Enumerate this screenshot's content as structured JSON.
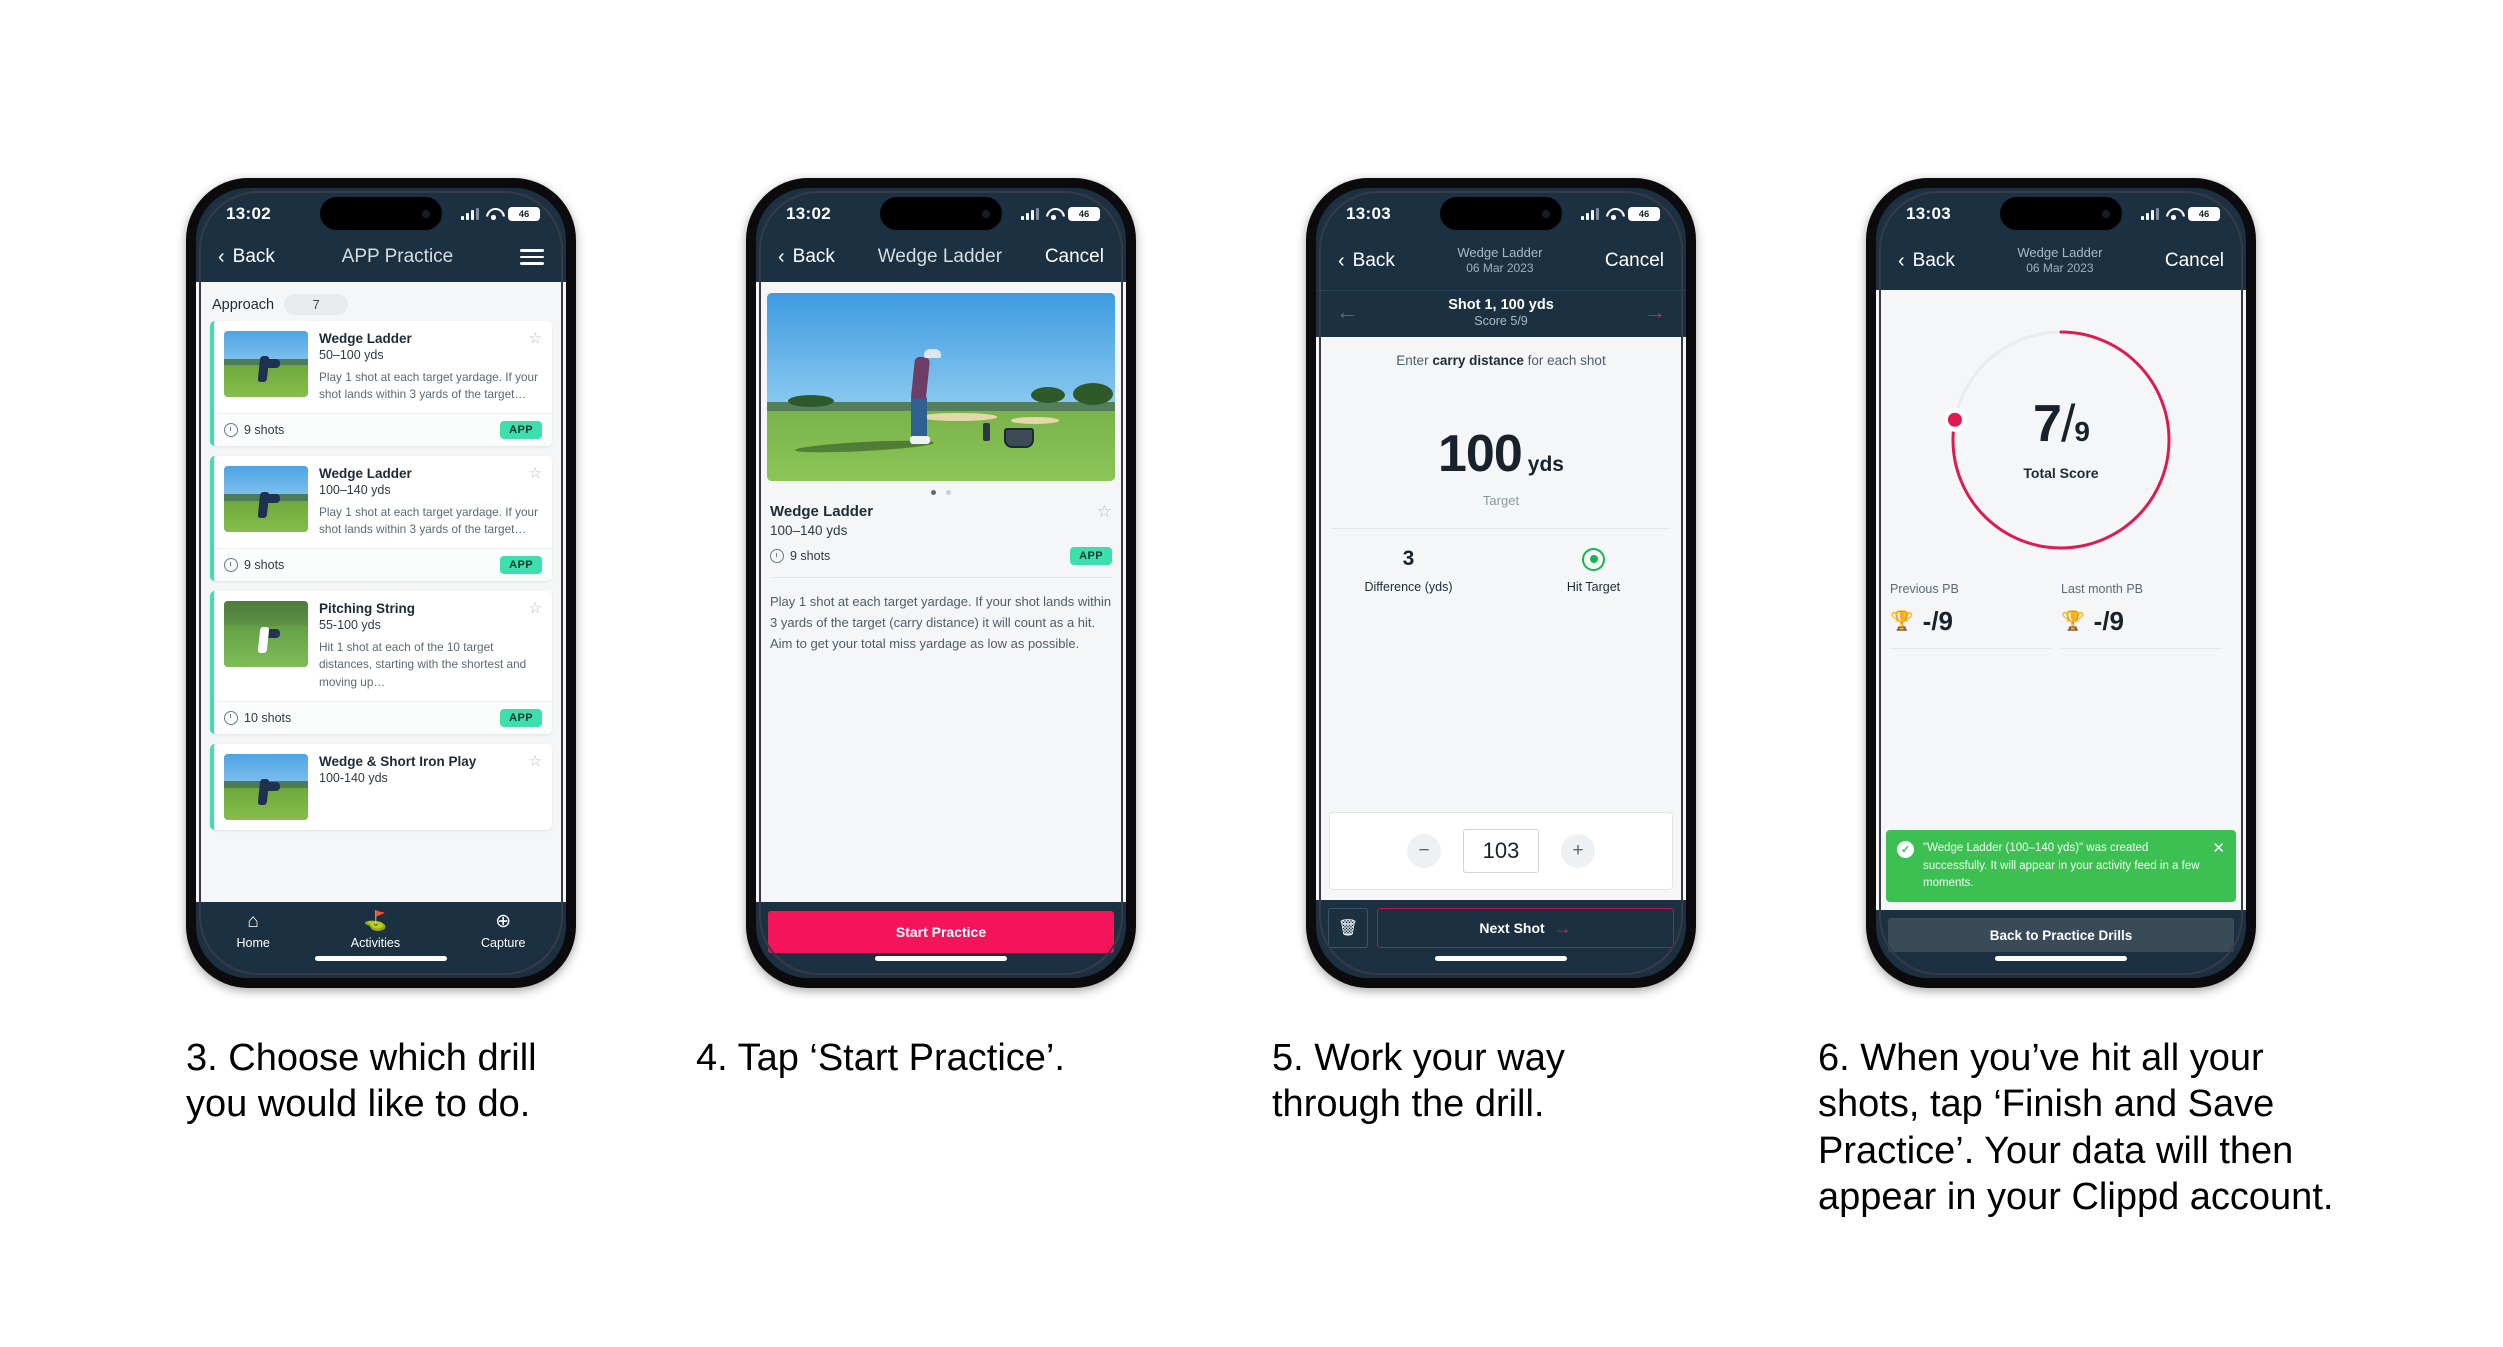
{
  "phones": [
    {
      "status": {
        "time": "13:02",
        "battery": "46"
      },
      "nav": {
        "back": "Back",
        "title": "APP Practice",
        "menu_icon": "hamburger-menu-icon"
      },
      "filter": {
        "label": "Approach",
        "count": "7"
      },
      "cards": [
        {
          "title": "Wedge Ladder",
          "range": "50–100 yds",
          "desc": "Play 1 shot at each target yardage. If your shot lands within 3 yards of the target…",
          "shots": "9 shots",
          "tag": "APP"
        },
        {
          "title": "Wedge Ladder",
          "range": "100–140 yds",
          "desc": "Play 1 shot at each target yardage. If your shot lands within 3 yards of the target…",
          "shots": "9 shots",
          "tag": "APP"
        },
        {
          "title": "Pitching String",
          "range": "55-100 yds",
          "desc": "Hit 1 shot at each of the 10 target distances, starting with the shortest and moving up…",
          "shots": "10 shots",
          "tag": "APP"
        },
        {
          "title": "Wedge & Short Iron Play",
          "range": "100-140 yds",
          "desc": "",
          "shots": "",
          "tag": ""
        }
      ],
      "tabs": [
        {
          "label": "Home",
          "icon": "home-icon"
        },
        {
          "label": "Activities",
          "icon": "golf-flag-icon"
        },
        {
          "label": "Capture",
          "icon": "plus-circle-icon"
        }
      ]
    },
    {
      "status": {
        "time": "13:02",
        "battery": "46"
      },
      "nav": {
        "back": "Back",
        "title": "Wedge Ladder",
        "cancel": "Cancel"
      },
      "detail": {
        "title": "Wedge Ladder",
        "range": "100–140 yds",
        "shots": "9 shots",
        "tag": "APP",
        "desc": "Play 1 shot at each target yardage. If your shot lands within 3 yards of the target (carry distance) it will count as a hit. Aim to get your total miss yardage as low as possible."
      },
      "cta": "Start Practice"
    },
    {
      "status": {
        "time": "13:03",
        "battery": "46"
      },
      "nav": {
        "back": "Back",
        "title": "Wedge Ladder",
        "subtitle": "06 Mar 2023",
        "cancel": "Cancel"
      },
      "shotbar": {
        "title": "Shot 1, 100 yds",
        "score": "Score 5/9",
        "prev_icon": "arrow-left-icon",
        "next_icon": "arrow-right-icon"
      },
      "hint_pre": "Enter ",
      "hint_bold": "carry distance",
      "hint_post": " for each shot",
      "target": {
        "value": "100",
        "unit": "yds",
        "label": "Target"
      },
      "stats": [
        {
          "value": "3",
          "label": "Difference (yds)"
        },
        {
          "value": "",
          "label": "Hit Target",
          "icon": "hit-target-icon"
        }
      ],
      "stepper": {
        "minus": "−",
        "value": "103",
        "plus": "+"
      },
      "bottom": {
        "delete_icon": "trash-icon",
        "next": "Next Shot"
      }
    },
    {
      "status": {
        "time": "13:03",
        "battery": "46"
      },
      "nav": {
        "back": "Back",
        "title": "Wedge Ladder",
        "subtitle": "06 Mar 2023",
        "cancel": "Cancel"
      },
      "summary": {
        "score": "7",
        "slash": "/",
        "denominator": "9",
        "label": "Total Score",
        "percent": 78
      },
      "pbs": [
        {
          "label": "Previous PB",
          "value": "-/9",
          "icon": "trophy-icon"
        },
        {
          "label": "Last month PB",
          "value": "-/9",
          "icon": "trophy-icon"
        }
      ],
      "toast": {
        "icon": "check-circle-icon",
        "message": "\"Wedge Ladder (100–140 yds)\" was created successfully. It will appear in your activity feed in a few moments.",
        "close_icon": "close-icon"
      },
      "button": "Back to Practice Drills"
    }
  ],
  "captions": [
    "3. Choose which drill you would like to do.",
    "4. Tap ‘Start Practice’.",
    "5. Work your way through the drill.",
    "6. When you’ve hit all your shots, tap ‘Finish and Save Practice’. Your data will then appear in your Clippd account."
  ],
  "colors": {
    "accent_pink": "#f4145b",
    "accent_teal": "#3ddfae",
    "nav_dark": "#1b3040",
    "toast_green": "#3cc051",
    "ring_pink": "#e0194f"
  }
}
